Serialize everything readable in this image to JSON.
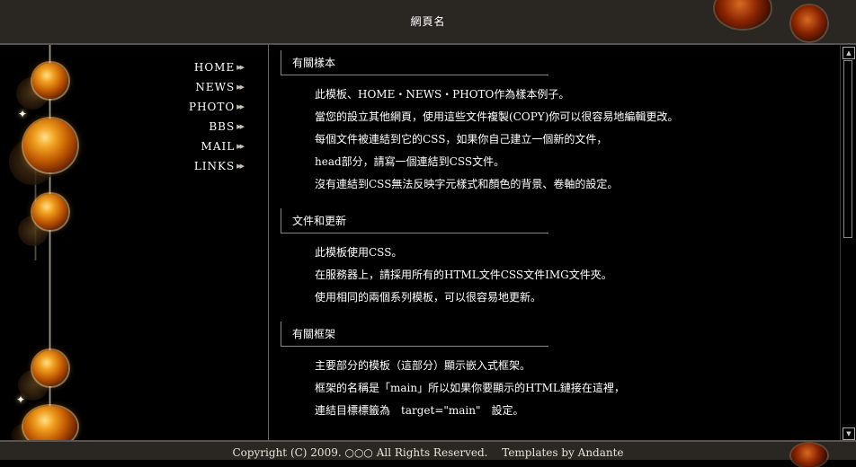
{
  "header": {
    "title": "網頁名"
  },
  "nav": {
    "items": [
      {
        "label": "HOME"
      },
      {
        "label": "NEWS"
      },
      {
        "label": "PHOTO"
      },
      {
        "label": "BBS"
      },
      {
        "label": "MAIL"
      },
      {
        "label": "LINKS"
      }
    ],
    "arrow_glyph": "▶▶"
  },
  "sections": [
    {
      "title": "有關樣本",
      "paragraphs": [
        "此模板、HOME・NEWS・PHOTO作為樣本例子。",
        "當您的設立其他網頁，使用這些文件複製(COPY)你可以很容易地編輯更改。",
        "每個文件被連結到它的CSS，如果你自己建立一個新的文件，",
        "head部分，請寫一個連結到CSS文件。",
        "沒有連結到CSS無法反映字元樣式和顏色的背景、卷軸的設定。"
      ]
    },
    {
      "title": "文件和更新",
      "paragraphs": [
        "此模板使用CSS。",
        "在服務器上，請採用所有的HTML文件CSS文件IMG文件夾。",
        "使用相同的兩個系列模板，可以很容易地更新。"
      ]
    },
    {
      "title": "有關框架",
      "paragraphs": [
        "主要部分的模板（這部分）顯示嵌入式框架。",
        "框架的名稱是「main」所以如果你要顯示的HTML鏈接在這裡，",
        "連結目標標籤為　target=\"main\"　設定。"
      ]
    }
  ],
  "footer": {
    "copyright": "Copyright (C) 2009. ○○○ All Rights Reserved.　 Templates by Andante"
  },
  "scrollbar": {
    "up_glyph": "▲",
    "down_glyph": "▼"
  },
  "colors": {
    "background": "#000000",
    "header_bg": "#2a2622",
    "text": "#ffffff",
    "accent_orb": "#f0a020"
  }
}
